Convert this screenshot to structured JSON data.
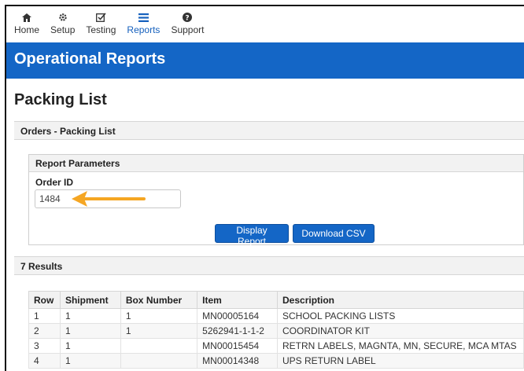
{
  "nav": {
    "items": [
      {
        "label": "Home",
        "icon": "home-icon",
        "active": false
      },
      {
        "label": "Setup",
        "icon": "gear-icon",
        "active": false
      },
      {
        "label": "Testing",
        "icon": "checkbox-icon",
        "active": false
      },
      {
        "label": "Reports",
        "icon": "list-icon",
        "active": true
      },
      {
        "label": "Support",
        "icon": "question-icon",
        "active": false
      }
    ]
  },
  "banner": {
    "title": "Operational Reports"
  },
  "page": {
    "title": "Packing List"
  },
  "orders_section": {
    "title": "Orders - Packing List"
  },
  "params": {
    "title": "Report Parameters",
    "order_id_label": "Order ID",
    "order_id_value": "1484"
  },
  "buttons": {
    "display": "Display Report",
    "csv": "Download CSV"
  },
  "results": {
    "title": "7 Results",
    "columns": [
      "Row",
      "Shipment",
      "Box Number",
      "Item",
      "Description"
    ],
    "rows": [
      [
        "1",
        "1",
        "1",
        "MN00005164",
        "SCHOOL PACKING LISTS"
      ],
      [
        "2",
        "1",
        "1",
        "5262941-1-1-2",
        "COORDINATOR KIT"
      ],
      [
        "3",
        "1",
        "",
        "MN00015454",
        "RETRN LABELS, MAGNTA, MN, SECURE, MCA MTAS"
      ],
      [
        "4",
        "1",
        "",
        "MN00014348",
        "UPS RETURN LABEL"
      ]
    ]
  },
  "colors": {
    "brand_blue": "#1466c6",
    "arrow_orange": "#f5a623"
  }
}
